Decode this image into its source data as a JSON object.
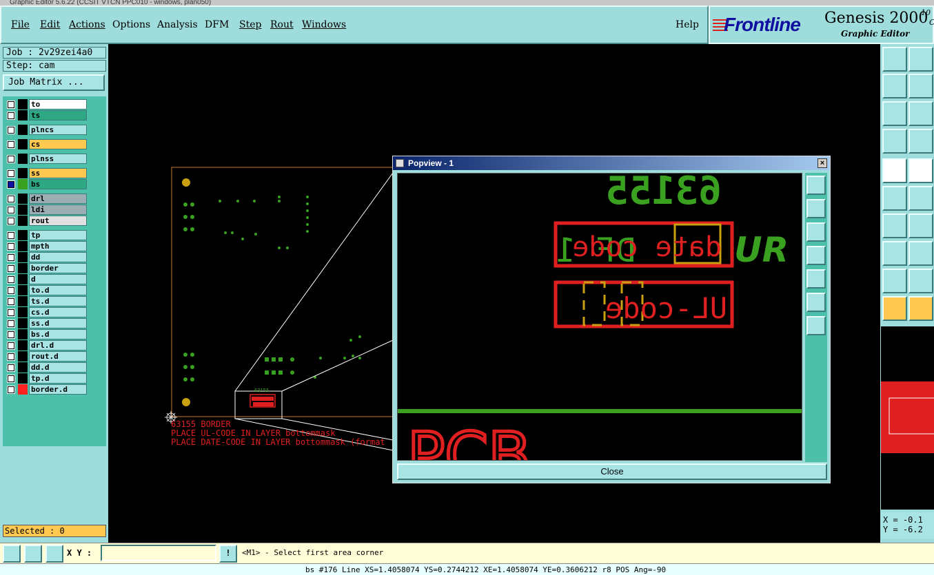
{
  "window": {
    "title": "Graphic Editor 5.6.22 (CCSIT VTCN PPC010 - windows, plan050)"
  },
  "menu": [
    {
      "label": "File"
    },
    {
      "label": "Edit"
    },
    {
      "label": "Actions"
    },
    {
      "label": "Options"
    },
    {
      "label": "Analysis"
    },
    {
      "label": "DFM"
    },
    {
      "label": "Step"
    },
    {
      "label": "Rout"
    },
    {
      "label": "Windows"
    },
    {
      "label": "Help"
    }
  ],
  "brand": {
    "logo": "Frontline",
    "product": "Genesis 2000",
    "version_a": "10",
    "version_b": "C",
    "subtitle": "Graphic Editor"
  },
  "job": {
    "job_label": "Job : 2v29zei4a0",
    "step_label": "Step: cam",
    "matrix_button": "Job Matrix ..."
  },
  "layers": [
    {
      "name": "to",
      "color": "#000000",
      "field": "#ffffff"
    },
    {
      "name": "ts",
      "color": "#000000",
      "field": "#2ea882"
    },
    {
      "name": "plncs",
      "color": "#000000",
      "field": "#a8e4e4"
    },
    {
      "name": "cs",
      "color": "#000000",
      "field": "#ffc850"
    },
    {
      "name": "plnss",
      "color": "#000000",
      "field": "#a8e4e4"
    },
    {
      "name": "ss",
      "color": "#000000",
      "field": "#ffc850"
    },
    {
      "name": "bs",
      "color": "#3aa020",
      "field": "#2ea882",
      "active": true
    },
    {
      "name": "drl",
      "color": "#000000",
      "field": "#9aaeb4"
    },
    {
      "name": "ldi",
      "color": "#000000",
      "field": "#9aaeb4"
    },
    {
      "name": "rout",
      "color": "#000000",
      "field": "#e0e0e0"
    },
    {
      "name": "tp",
      "color": "#000000",
      "field": "#a8e4e4"
    },
    {
      "name": "mpth",
      "color": "#000000",
      "field": "#a8e4e4"
    },
    {
      "name": "dd",
      "color": "#000000",
      "field": "#a8e4e4"
    },
    {
      "name": "border",
      "color": "#000000",
      "field": "#a8e4e4"
    },
    {
      "name": "d",
      "color": "#000000",
      "field": "#a8e4e4"
    },
    {
      "name": "to.d",
      "color": "#000000",
      "field": "#a8e4e4"
    },
    {
      "name": "ts.d",
      "color": "#000000",
      "field": "#a8e4e4"
    },
    {
      "name": "cs.d",
      "color": "#000000",
      "field": "#a8e4e4"
    },
    {
      "name": "ss.d",
      "color": "#000000",
      "field": "#a8e4e4"
    },
    {
      "name": "bs.d",
      "color": "#000000",
      "field": "#a8e4e4"
    },
    {
      "name": "drl.d",
      "color": "#000000",
      "field": "#a8e4e4"
    },
    {
      "name": "rout.d",
      "color": "#000000",
      "field": "#a8e4e4"
    },
    {
      "name": "dd.d",
      "color": "#000000",
      "field": "#a8e4e4"
    },
    {
      "name": "tp.d",
      "color": "#000000",
      "field": "#a8e4e4"
    },
    {
      "name": "border.d",
      "color": "#ff2020",
      "field": "#a8e4e4"
    }
  ],
  "selected": "Selected : 0",
  "canvas": {
    "board_text_1": "63155  BORDER",
    "board_text_2": "PLACE UL-CODE IN LAYER bottommask",
    "board_text_3": "PLACE DATE-CODE IN LAYER bottommask (format",
    "mini_label": "63155"
  },
  "popview": {
    "title": "Popview - 1",
    "close_x": "×",
    "close_button": "Close",
    "text_number": "63155",
    "text_datecode": "date code",
    "text_ulcode": "UL-code",
    "text_df": "DF 1",
    "text_ur": "UR",
    "text_bottom": "PCB"
  },
  "coords": {
    "x": "X = -0.1",
    "y": "Y = -6.2"
  },
  "bottom": {
    "xy_label": "X Y :",
    "xy_value": "",
    "message": "<M1> - Select first area corner"
  },
  "status": "bs #176 Line XS=1.4058074 YS=0.2744212 XE=1.4058074 YE=0.3606212 r8 POS Ang=-90"
}
